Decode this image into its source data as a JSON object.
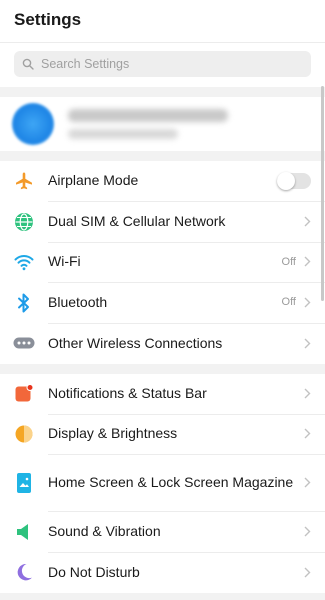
{
  "header": {
    "title": "Settings"
  },
  "search": {
    "placeholder": "Search Settings"
  },
  "connectivity": [
    {
      "label": "Airplane Mode",
      "icon": "airplane-icon",
      "control": "toggle",
      "toggle_on": false
    },
    {
      "label": "Dual SIM & Cellular Network",
      "icon": "globe-icon"
    },
    {
      "label": "Wi-Fi",
      "icon": "wifi-icon",
      "value": "Off"
    },
    {
      "label": "Bluetooth",
      "icon": "bluetooth-icon",
      "value": "Off"
    },
    {
      "label": "Other Wireless Connections",
      "icon": "more-icon"
    }
  ],
  "display": [
    {
      "label": "Notifications & Status Bar",
      "icon": "notifications-icon"
    },
    {
      "label": "Display & Brightness",
      "icon": "brightness-icon"
    },
    {
      "label": "Home Screen & Lock Screen Magazine",
      "icon": "home-screen-icon"
    },
    {
      "label": "Sound & Vibration",
      "icon": "sound-icon"
    },
    {
      "label": "Do Not Disturb",
      "icon": "moon-icon"
    }
  ],
  "colors": {
    "airplane": "#f39a2a",
    "globe": "#2ec27e",
    "wifi": "#1ea8e6",
    "bluetooth": "#1e9be8",
    "more": "#8a8f99",
    "notifications": "#f2673a",
    "brightness": "#f5a623",
    "home_screen": "#1fb4e5",
    "sound": "#2ec27e",
    "moon": "#8f6fe0"
  }
}
